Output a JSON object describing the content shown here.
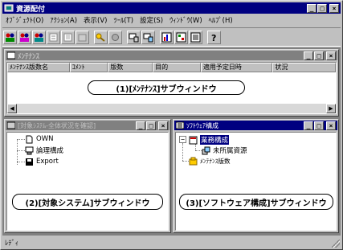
{
  "app": {
    "title": "資源配付"
  },
  "menu": [
    "ｵﾌﾞｼﾞｪｸﾄ(O)",
    "ｱｸｼｮﾝ(A)",
    "表示(V)",
    "ﾂｰﾙ(T)",
    "設定(S)",
    "ｳｨﾝﾄﾞｳ(W)",
    "ﾍﾙﾌﾟ(H)"
  ],
  "toolbar_icons": [
    "users-add-icon",
    "users-remove-icon",
    "users-move-icon",
    "schedule-icon",
    "computer-list-icon",
    "package-icon",
    "key-icon",
    "settings-icon",
    "monitor-icon",
    "monitor-network-icon",
    "chart-icon",
    "dashboard-icon",
    "help-icon"
  ],
  "maintenance": {
    "title": "ﾒﾝﾃﾅﾝｽ",
    "columns": [
      "ﾒﾝﾃﾅﾝｽ版数名",
      "ｺﾒﾝﾄ",
      "版数",
      "目的",
      "適用予定日時",
      "状況"
    ],
    "callout": "(1)[ﾒﾝﾃﾅﾝｽ]サブウィンドウ"
  },
  "target_system": {
    "title": "[対象ｼｽﾃﾑ-全体状況を確認]",
    "items": [
      "OWN",
      "論理構成",
      "Export"
    ],
    "callout": "(2)[対象システム]サブウィンドウ"
  },
  "software": {
    "title": "ｿﾌﾄｳｪｱ構成",
    "items": [
      "業務構成",
      "未所属資源",
      "ﾒﾝﾃﾅﾝｽ版数"
    ],
    "callout": "(3)[ソフトウェア構成]サブウィンドウ"
  },
  "status": {
    "text": "ﾚﾃﾞｨ"
  },
  "colors": {
    "active_title": "#000080",
    "inactive_title": "#808080",
    "face": "#c0c0c0"
  }
}
